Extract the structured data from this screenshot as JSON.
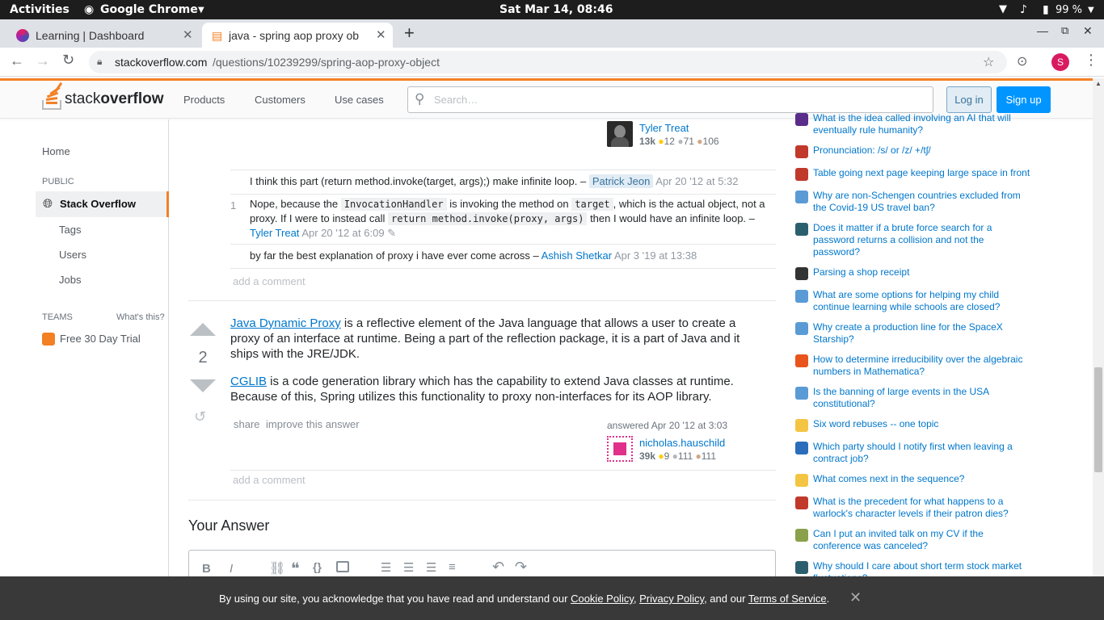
{
  "system": {
    "activities": "Activities",
    "app_name": "Google Chrome",
    "clock": "Sat Mar 14, 08:46",
    "battery": "99 %"
  },
  "browser": {
    "tabs": [
      {
        "title": "Learning | Dashboard"
      },
      {
        "title": "java - spring aop proxy ob"
      }
    ],
    "url_host": "stackoverflow.com",
    "url_path": "/questions/10239299/spring-aop-proxy-object",
    "profile_initial": "S"
  },
  "so_header": {
    "logo_stack": "stack",
    "logo_overflow": "overflow",
    "nav": [
      "Products",
      "Customers",
      "Use cases"
    ],
    "search_placeholder": "Search…",
    "login_label": "Log in",
    "signup_label": "Sign up"
  },
  "left_nav": {
    "home": "Home",
    "public_label": "PUBLIC",
    "stack_overflow": "Stack Overflow",
    "tags": "Tags",
    "users": "Users",
    "jobs": "Jobs",
    "teams_label": "TEAMS",
    "whats_this": "What's this?",
    "free_trial": "Free 30 Day Trial"
  },
  "prev_answer_user": {
    "name": "Tyler Treat",
    "rep": "13k",
    "gold": "12",
    "silver": "71",
    "bronze": "106"
  },
  "comments": [
    {
      "score": "",
      "text": "I think this part (return method.invoke(target, args);) make infinite loop. –",
      "user": "Patrick Jeon",
      "date": "Apr 20 '12 at 5:32"
    },
    {
      "score": "1",
      "text_a": "Nope, because the",
      "code_a": "InvocationHandler",
      "text_b": "is invoking the method on",
      "code_b": "target",
      "text_c": ", which is the actual object, not a proxy. If I were to instead call",
      "code_c": "return method.invoke(proxy, args)",
      "text_d": "then I would have an infinite loop. –",
      "user": "Tyler Treat",
      "date": "Apr 20 '12 at 6:09"
    },
    {
      "score": "",
      "text": "by far the best explanation of proxy i have ever come across –",
      "user": "Ashish Shetkar",
      "date": "Apr 3 '19 at 13:38"
    }
  ],
  "add_comment": "add a comment",
  "answer": {
    "votes": "2",
    "p1_link": "Java Dynamic Proxy",
    "p1_text": " is a reflective element of the Java language that allows a user to create a proxy of an interface at runtime. Being a part of the reflection package, it is a part of Java and it ships with the JRE/JDK.",
    "p2_link": "CGLIB",
    "p2_text": " is a code generation library which has the capability to extend Java classes at runtime. Because of this, Spring utilizes this functionality to proxy non-interfaces for its AOP library.",
    "share": "share",
    "improve": "improve this answer",
    "answered": "answered Apr 20 '12 at 3:03",
    "user": "nicholas.hauschild",
    "rep": "39k",
    "gold": "9",
    "silver": "111",
    "bronze": "111"
  },
  "your_answer": "Your Answer",
  "hot_questions": [
    {
      "title": "What is the idea called involving an AI that will eventually rule humanity?",
      "icon_color": "#5a2d8a"
    },
    {
      "title": "Pronunciation: /s/ or /z/ +/tʃ/",
      "icon_color": "#c0392b"
    },
    {
      "title": "Table going next page keeping large space in front",
      "icon_color": "#c0392b"
    },
    {
      "title": "Why are non-Schengen countries excluded from the Covid-19 US travel ban?",
      "icon_color": "#5b9bd5"
    },
    {
      "title": "Does it matter if a brute force search for a password returns a collision and not the password?",
      "icon_color": "#2c5f6e"
    },
    {
      "title": "Parsing a shop receipt",
      "icon_color": "#333333"
    },
    {
      "title": "What are some options for helping my child continue learning while schools are closed?",
      "icon_color": "#5b9bd5"
    },
    {
      "title": "Why create a production line for the SpaceX Starship?",
      "icon_color": "#5b9bd5"
    },
    {
      "title": "How to determine irreducibility over the algebraic numbers in Mathematica?",
      "icon_color": "#e8541c"
    },
    {
      "title": "Is the banning of large events in the USA constitutional?",
      "icon_color": "#5b9bd5"
    },
    {
      "title": "Six word rebuses -- one topic",
      "icon_color": "#f4c542"
    },
    {
      "title": "Which party should I notify first when leaving a contract job?",
      "icon_color": "#2a6ebb"
    },
    {
      "title": "What comes next in the sequence?",
      "icon_color": "#f4c542"
    },
    {
      "title": "What is the precedent for what happens to a warlock's character levels if their patron dies?",
      "icon_color": "#c0392b"
    },
    {
      "title": "Can I put an invited talk on my CV if the conference was canceled?",
      "icon_color": "#8aa04a"
    },
    {
      "title": "Why should I care about short term stock market fluctuations?",
      "icon_color": "#2c5f6e"
    }
  ],
  "cookie": {
    "prefix": "By using our site, you acknowledge that you have read and understand our",
    "cookie_policy": "Cookie Policy",
    "sep1": ",",
    "privacy_policy": "Privacy Policy",
    "sep2": ", and our",
    "terms": "Terms of Service",
    "suffix": "."
  }
}
